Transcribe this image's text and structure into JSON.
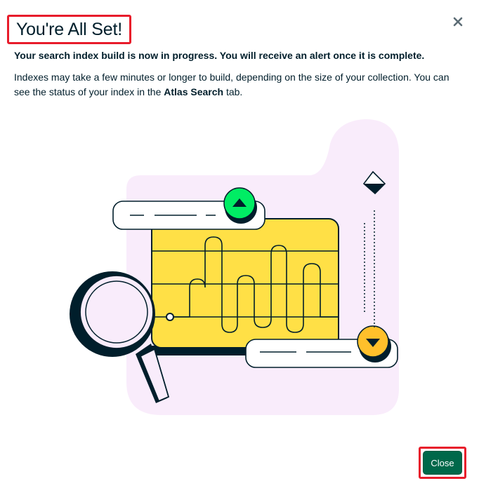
{
  "modal": {
    "title": "You're All Set!",
    "subtitle": "Your search index build is now in progress. You will receive an alert once it is complete.",
    "description_before": "Indexes may take a few minutes or longer to build, depending on the size of your collection. You can see the status of your index in the ",
    "description_link": "Atlas Search",
    "description_after": " tab.",
    "close_icon": "close-icon",
    "close_label": "Close"
  },
  "illustration": {
    "name": "search-index-illustration",
    "colors": {
      "blob": "#f9ecfb",
      "card": "#ffe046",
      "green_button": "#00ed64",
      "yellow_button": "#ffc02b",
      "ink": "#001e2b"
    }
  }
}
